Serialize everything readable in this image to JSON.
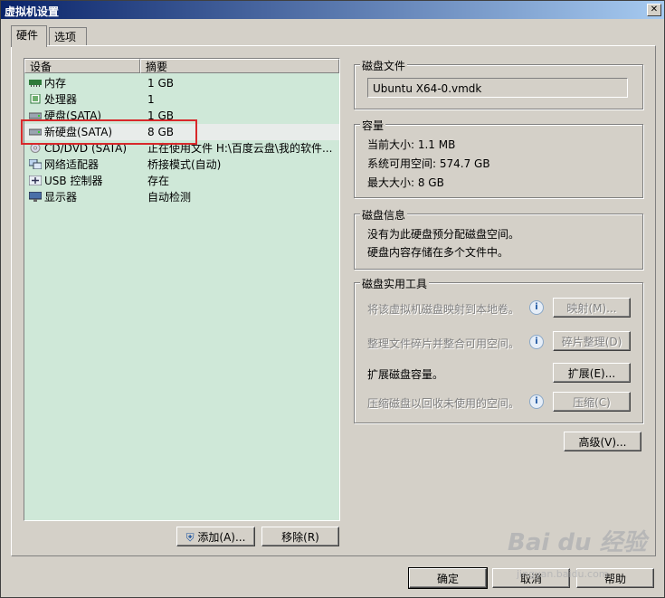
{
  "window": {
    "title": "虚拟机设置"
  },
  "tabs": [
    {
      "label": "硬件"
    },
    {
      "label": "选项"
    }
  ],
  "device_list": {
    "headers": {
      "device": "设备",
      "summary": "摘要"
    },
    "rows": [
      {
        "name": "内存",
        "summary": "1 GB",
        "icon": "memory-icon"
      },
      {
        "name": "处理器",
        "summary": "1",
        "icon": "processor-icon"
      },
      {
        "name": "硬盘(SATA)",
        "summary": "1 GB",
        "icon": "hard-disk-icon"
      },
      {
        "name": "新硬盘(SATA)",
        "summary": "8 GB",
        "icon": "hard-disk-icon"
      },
      {
        "name": "CD/DVD (SATA)",
        "summary": "正在使用文件 H:\\百度云盘\\我的软件...",
        "icon": "cd-dvd-icon"
      },
      {
        "name": "网络适配器",
        "summary": "桥接模式(自动)",
        "icon": "network-adapter-icon"
      },
      {
        "name": "USB 控制器",
        "summary": "存在",
        "icon": "usb-icon"
      },
      {
        "name": "显示器",
        "summary": "自动检测",
        "icon": "display-icon"
      }
    ]
  },
  "buttons": {
    "add": "添加(A)...",
    "remove": "移除(R)",
    "ok": "确定",
    "cancel": "取消",
    "help": "帮助",
    "advanced": "高级(V)..."
  },
  "disk_file": {
    "legend": "磁盘文件",
    "value": "Ubuntu X64-0.vmdk"
  },
  "capacity": {
    "legend": "容量",
    "current_size": "当前大小: 1.1 MB",
    "available_space": "系统可用空间: 574.7 GB",
    "max_size": "最大大小: 8 GB"
  },
  "disk_info": {
    "legend": "磁盘信息",
    "line1": "没有为此硬盘预分配磁盘空间。",
    "line2": "硬盘内容存储在多个文件中。"
  },
  "disk_utilities": {
    "legend": "磁盘实用工具",
    "map_text": "将该虚拟机磁盘映射到本地卷。",
    "map_button": "映射(M)...",
    "defrag_text": "整理文件碎片并整合可用空间。",
    "defrag_button": "碎片整理(D)",
    "expand_text": "扩展磁盘容量。",
    "expand_button": "扩展(E)...",
    "compact_text": "压缩磁盘以回收未使用的空间。",
    "compact_button": "压缩(C)"
  },
  "watermark": {
    "brand": "Bai du 经验",
    "url": "jingyan.baidu.com"
  }
}
